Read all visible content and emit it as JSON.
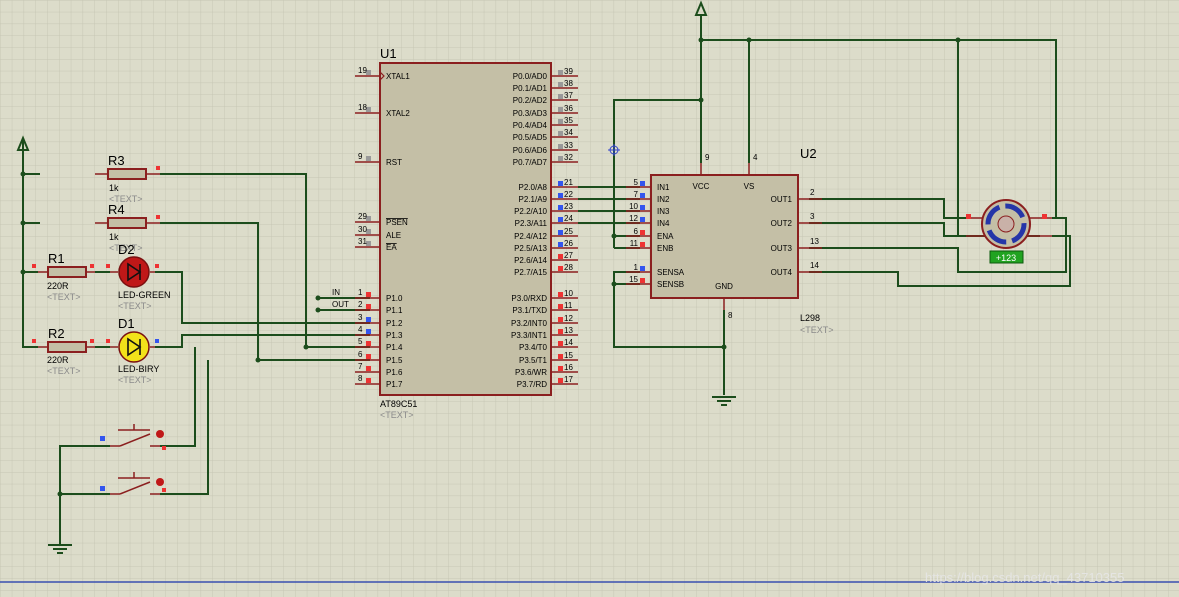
{
  "colors": {
    "background": "#dcdcca",
    "grid": "#c6c6b4",
    "wire": "#1c4d1c",
    "component_body": "#c4bfa6",
    "component_outline": "#8b1f1f",
    "pin_high": "#ee3333",
    "pin_low": "#3355ee",
    "led_green": "#c01818",
    "led_yellow": "#f2e21a",
    "motor_display": "#21a321"
  },
  "u1": {
    "ref": "U1",
    "part": "AT89C51",
    "text": "<TEXT>",
    "pins_left": [
      {
        "num": "19",
        "name": "XTAL1"
      },
      {
        "num": "18",
        "name": "XTAL2"
      },
      {
        "num": "9",
        "name": "RST"
      },
      {
        "num": "29",
        "name": "PSEN"
      },
      {
        "num": "30",
        "name": "ALE"
      },
      {
        "num": "31",
        "name": "EA"
      },
      {
        "num": "1",
        "name": "P1.0"
      },
      {
        "num": "2",
        "name": "P1.1"
      },
      {
        "num": "3",
        "name": "P1.2"
      },
      {
        "num": "4",
        "name": "P1.3"
      },
      {
        "num": "5",
        "name": "P1.4"
      },
      {
        "num": "6",
        "name": "P1.5"
      },
      {
        "num": "7",
        "name": "P1.6"
      },
      {
        "num": "8",
        "name": "P1.7"
      }
    ],
    "pins_right": [
      {
        "num": "39",
        "name": "P0.0/AD0"
      },
      {
        "num": "38",
        "name": "P0.1/AD1"
      },
      {
        "num": "37",
        "name": "P0.2/AD2"
      },
      {
        "num": "36",
        "name": "P0.3/AD3"
      },
      {
        "num": "35",
        "name": "P0.4/AD4"
      },
      {
        "num": "34",
        "name": "P0.5/AD5"
      },
      {
        "num": "33",
        "name": "P0.6/AD6"
      },
      {
        "num": "32",
        "name": "P0.7/AD7"
      },
      {
        "num": "21",
        "name": "P2.0/A8"
      },
      {
        "num": "22",
        "name": "P2.1/A9"
      },
      {
        "num": "23",
        "name": "P2.2/A10"
      },
      {
        "num": "24",
        "name": "P2.3/A11"
      },
      {
        "num": "25",
        "name": "P2.4/A12"
      },
      {
        "num": "26",
        "name": "P2.5/A13"
      },
      {
        "num": "27",
        "name": "P2.6/A14"
      },
      {
        "num": "28",
        "name": "P2.7/A15"
      },
      {
        "num": "10",
        "name": "P3.0/RXD"
      },
      {
        "num": "11",
        "name": "P3.1/TXD"
      },
      {
        "num": "12",
        "name": "P3.2/INT0"
      },
      {
        "num": "13",
        "name": "P3.3/INT1"
      },
      {
        "num": "14",
        "name": "P3.4/T0"
      },
      {
        "num": "15",
        "name": "P3.5/T1"
      },
      {
        "num": "16",
        "name": "P3.6/WR"
      },
      {
        "num": "17",
        "name": "P3.7/RD"
      }
    ]
  },
  "u2": {
    "ref": "U2",
    "part": "L298",
    "text": "<TEXT>",
    "pins_left": [
      {
        "num": "5",
        "name": "IN1"
      },
      {
        "num": "7",
        "name": "IN2"
      },
      {
        "num": "10",
        "name": "IN3"
      },
      {
        "num": "12",
        "name": "IN4"
      },
      {
        "num": "6",
        "name": "ENA"
      },
      {
        "num": "11",
        "name": "ENB"
      },
      {
        "num": "1",
        "name": "SENSA"
      },
      {
        "num": "15",
        "name": "SENSB"
      }
    ],
    "pins_right": [
      {
        "num": "2",
        "name": "OUT1"
      },
      {
        "num": "3",
        "name": "OUT2"
      },
      {
        "num": "13",
        "name": "OUT3"
      },
      {
        "num": "14",
        "name": "OUT4"
      }
    ],
    "pins_top": [
      {
        "num": "9",
        "name": "VCC"
      },
      {
        "num": "4",
        "name": "VS"
      }
    ],
    "pins_bottom": [
      {
        "num": "8",
        "name": "GND"
      }
    ]
  },
  "resistors": [
    {
      "ref": "R3",
      "value": "1k",
      "text": "<TEXT>"
    },
    {
      "ref": "R4",
      "value": "1k",
      "text": "<TEXT>"
    },
    {
      "ref": "R1",
      "value": "220R",
      "text": "<TEXT>"
    },
    {
      "ref": "R2",
      "value": "220R",
      "text": "<TEXT>"
    }
  ],
  "leds": [
    {
      "ref": "D2",
      "value": "LED-GREEN",
      "text": "<TEXT>"
    },
    {
      "ref": "D1",
      "value": "LED-BIRY",
      "text": "<TEXT>"
    }
  ],
  "net_labels": {
    "in": "IN",
    "out": "OUT"
  },
  "motor": {
    "readout": "+123"
  },
  "watermark": "https://blog.csdn.net/qq_43710355"
}
